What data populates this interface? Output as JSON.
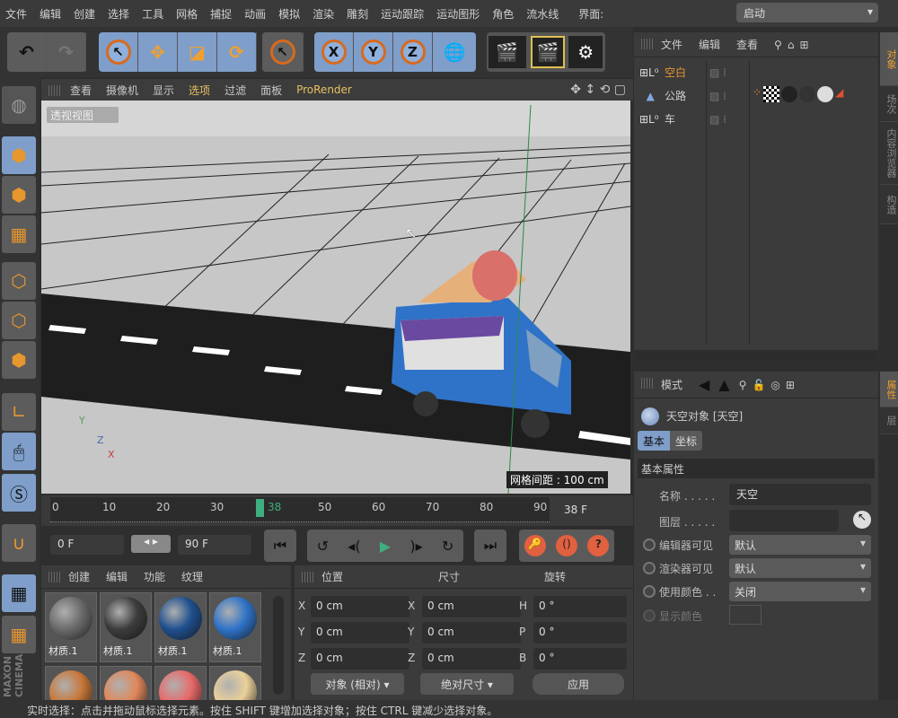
{
  "menu": {
    "items": [
      "文件",
      "编辑",
      "创建",
      "选择",
      "工具",
      "网格",
      "捕捉",
      "动画",
      "模拟",
      "渲染",
      "雕刻",
      "运动跟踪",
      "运动图形",
      "角色",
      "流水线"
    ],
    "layout_label": "界面:",
    "layout_value": "启动"
  },
  "toolbar": {
    "x": "X",
    "y": "Y",
    "z": "Z"
  },
  "viewport": {
    "menu": [
      "查看",
      "摄像机",
      "显示",
      "选项",
      "过滤",
      "面板",
      "ProRender"
    ],
    "camera_label": "透视视图",
    "grid_spacing": "网格间距 : 100 cm",
    "axis_y": "Y",
    "axis_z": "Z",
    "axis_x": "X"
  },
  "timeline": {
    "ticks": [
      "0",
      "10",
      "20",
      "30",
      "50",
      "60",
      "70",
      "80",
      "90"
    ],
    "current": "38",
    "current_frame_field": "38 F",
    "start_field": "0 F",
    "end_field": "90 F",
    "progress": 0.42
  },
  "materials": {
    "menu": [
      "创建",
      "编辑",
      "功能",
      "纹理"
    ],
    "items": [
      {
        "label": "材质.1",
        "color": "#6a6a6a"
      },
      {
        "label": "材质.1",
        "color": "#3c3c3c"
      },
      {
        "label": "材质.1",
        "color": "#1f4f8e"
      },
      {
        "label": "材质.1",
        "color": "#2f73c8"
      },
      {
        "label": "",
        "color": "#c8783a"
      },
      {
        "label": "",
        "color": "#e0885a"
      },
      {
        "label": "",
        "color": "#e86a6a"
      },
      {
        "label": "",
        "color": "#ead09a"
      }
    ]
  },
  "coordinates": {
    "headers": [
      "位置",
      "尺寸",
      "旋转"
    ],
    "rows": [
      {
        "pos_axis": "X",
        "pos": "0 cm",
        "size_axis": "X",
        "size": "0 cm",
        "rot_axis": "H",
        "rot": "0 °"
      },
      {
        "pos_axis": "Y",
        "pos": "0 cm",
        "size_axis": "Y",
        "size": "0 cm",
        "rot_axis": "P",
        "rot": "0 °"
      },
      {
        "pos_axis": "Z",
        "pos": "0 cm",
        "size_axis": "Z",
        "size": "0 cm",
        "rot_axis": "B",
        "rot": "0 °"
      }
    ],
    "mode": "对象 (相对)",
    "size_mode": "绝对尺寸",
    "apply": "应用"
  },
  "objects": {
    "menu": [
      "文件",
      "编辑",
      "查看"
    ],
    "items": [
      {
        "name": "空白",
        "active": true
      },
      {
        "name": "公路",
        "active": false
      },
      {
        "name": "车",
        "active": false
      }
    ]
  },
  "attributes": {
    "menu": "模式",
    "title": "天空对象 [天空]",
    "tabs": [
      "基本",
      "坐标"
    ],
    "section": "基本属性",
    "fields": [
      {
        "label": "名称 . . . . .",
        "value": "天空"
      },
      {
        "label": "图层 . . . . .",
        "value": ""
      },
      {
        "label": "编辑器可见",
        "value": "默认"
      },
      {
        "label": "渲染器可见",
        "value": "默认"
      },
      {
        "label": "使用颜色 . .",
        "value": "关闭"
      },
      {
        "label": "显示颜色",
        "value": ""
      }
    ]
  },
  "right_tabs": [
    "对象",
    "场次",
    "内容浏览器",
    "构造",
    "属性",
    "层"
  ],
  "status": "实时选择：点击并拖动鼠标选择元素。按住 SHIFT 键增加选择对象；按住 CTRL 键减少选择对象。",
  "colors": {
    "accent": "#f0a030",
    "selected_blue": "#7f9ec9",
    "timeline_marker": "#3fae7f"
  }
}
